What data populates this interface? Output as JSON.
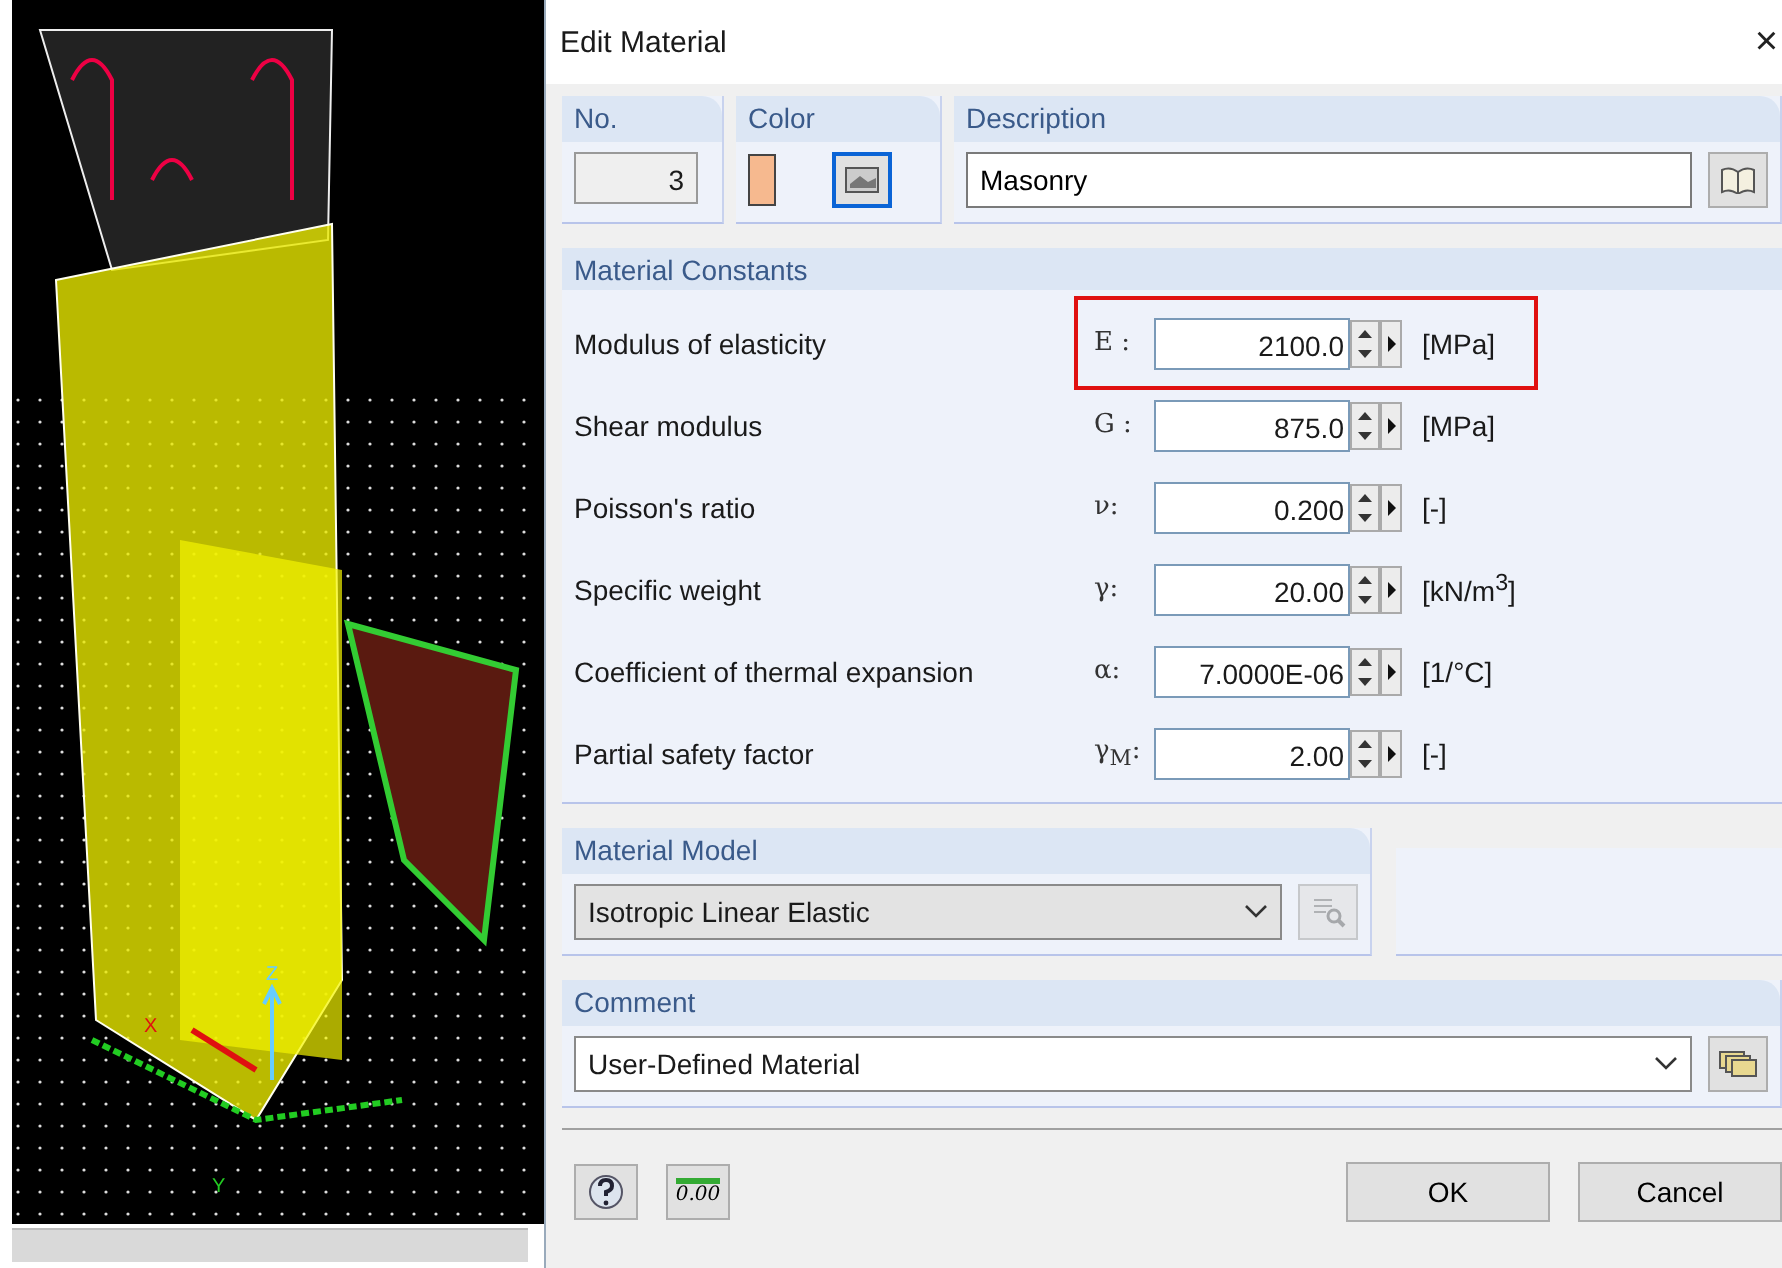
{
  "viewport": {
    "axis_labels": [
      "Z",
      "X",
      "Y"
    ]
  },
  "dialog": {
    "title": "Edit Material",
    "close": "×",
    "number": {
      "label": "No.",
      "value": "3"
    },
    "color": {
      "label": "Color"
    },
    "description": {
      "label": "Description",
      "value": "Masonry"
    },
    "constants": {
      "title": "Material Constants",
      "rows": [
        {
          "label": "Modulus of elasticity",
          "symbol": "E :",
          "value": "2100.0",
          "unit": "[MPa]",
          "highlighted": true
        },
        {
          "label": "Shear modulus",
          "symbol": "G :",
          "value": "875.0",
          "unit": "[MPa]",
          "highlighted": false
        },
        {
          "label": "Poisson's ratio",
          "symbol": "ν:",
          "value": "0.200",
          "unit": "[-]",
          "highlighted": false
        },
        {
          "label": "Specific weight",
          "symbol": "γ:",
          "value": "20.00",
          "unit": "[kN/m$^{3}$]",
          "highlighted": false
        },
        {
          "label": "Coefficient of thermal expansion",
          "symbol": "α:",
          "value": "7.0000E-06",
          "unit": "[1/°C]",
          "highlighted": false
        },
        {
          "label": "Partial safety factor",
          "symbol": "γ$_{M}$:",
          "value": "2.00",
          "unit": "[-]",
          "highlighted": false
        }
      ]
    },
    "material_model": {
      "title": "Material Model",
      "value": "Isotropic Linear Elastic",
      "disabled": true
    },
    "comment": {
      "title": "Comment",
      "value": "User-Defined Material"
    },
    "units_button": "0.00",
    "buttons": [
      "OK",
      "Cancel"
    ]
  }
}
